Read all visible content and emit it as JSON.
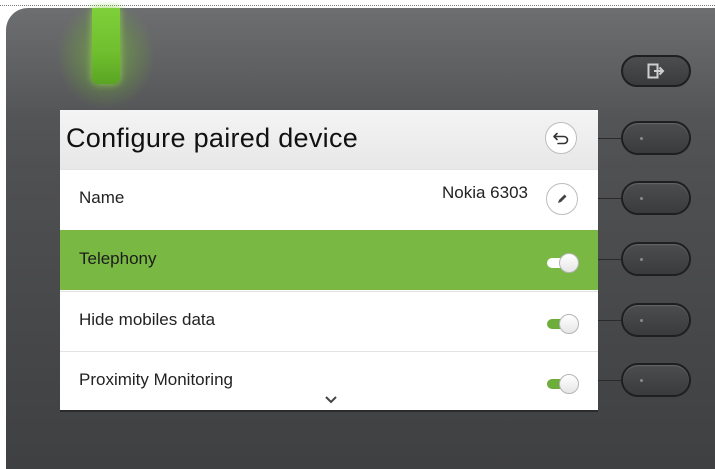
{
  "screen": {
    "title": "Configure paired device",
    "rows": [
      {
        "label": "Name",
        "value": "Nokia 6303",
        "control": "edit-button"
      },
      {
        "label": "Telephony",
        "control": "toggle",
        "state": "on",
        "selected": true
      },
      {
        "label": "Hide mobiles data",
        "control": "toggle",
        "state": "on",
        "selected": false
      },
      {
        "label": "Proximity Monitoring",
        "control": "toggle",
        "state": "on",
        "selected": false
      }
    ],
    "icons": {
      "back": "back-arrow-icon",
      "edit": "pencil-icon",
      "scroll": "chevron-down-icon",
      "exit": "exit-icon"
    }
  },
  "colors": {
    "accent_green": "#78b843",
    "toggle_on": "#6dad3a",
    "toggle_on_selected": "#ffffff",
    "led_green": "#7ed03a"
  }
}
